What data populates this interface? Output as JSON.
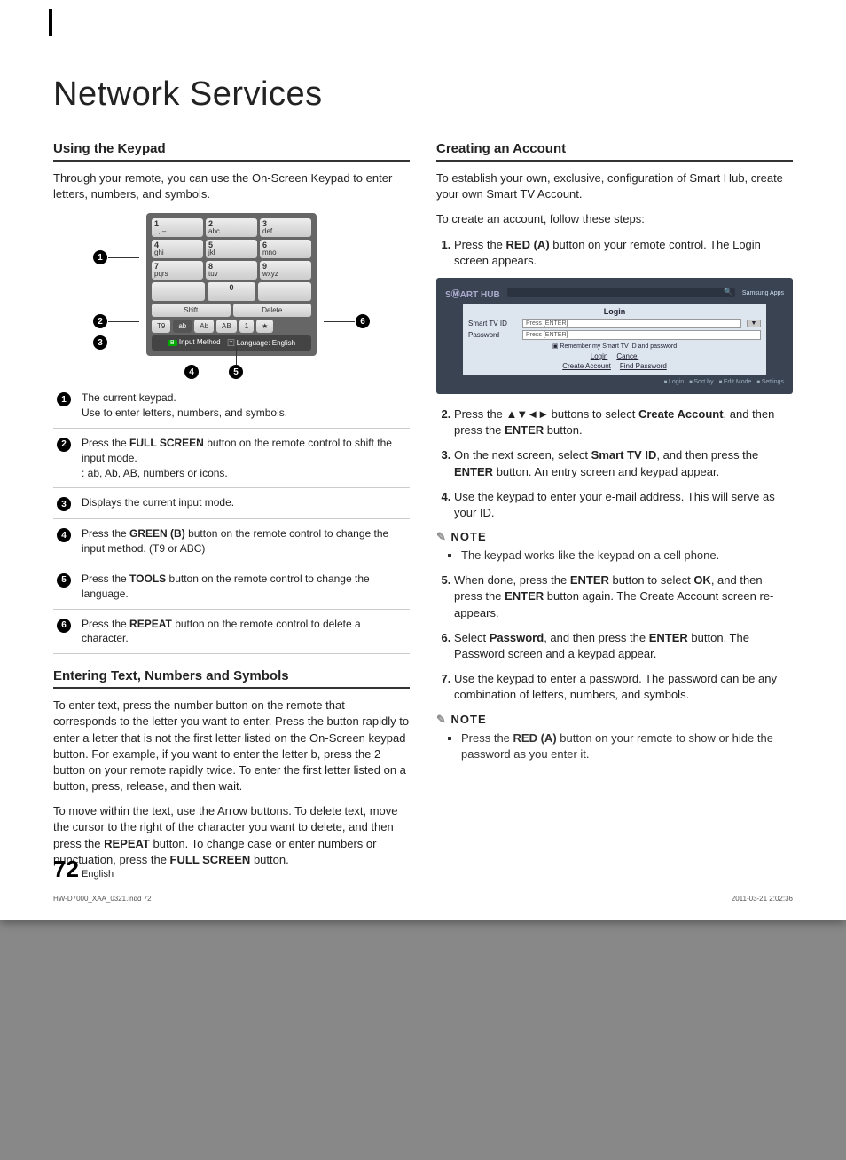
{
  "title": "Network Services",
  "left": {
    "h_keypad": "Using the Keypad",
    "p_keypad": "Through your remote, you can use the On-Screen Keypad to enter letters, numbers, and symbols.",
    "h_entering": "Entering Text, Numbers and Symbols",
    "p_entering1": "To enter text, press the number button on the remote that corresponds to the letter you want to enter. Press the button rapidly to enter a letter that is not the first letter listed on the On-Screen keypad button. For example, if you want to enter the letter b, press the 2 button on your remote rapidly twice. To enter the first letter listed on a button, press, release, and then wait.",
    "p_entering2a": "To move within the text, use the Arrow buttons. To delete text, move the cursor to the right of the character you want to delete, and then press the",
    "p_entering2_bold1": "REPEAT",
    "p_entering2b": "button. To change case or enter numbers or punctuation, press the",
    "p_entering2_bold2": "FULL SCREEN",
    "p_entering2c": "button."
  },
  "keypad": {
    "keys": [
      {
        "n": "1",
        "s": ". , –"
      },
      {
        "n": "2",
        "s": "abc"
      },
      {
        "n": "3",
        "s": "def"
      },
      {
        "n": "4",
        "s": "ghi"
      },
      {
        "n": "5",
        "s": "jkl"
      },
      {
        "n": "6",
        "s": "mno"
      },
      {
        "n": "7",
        "s": "pqrs"
      },
      {
        "n": "8",
        "s": "tuv"
      },
      {
        "n": "9",
        "s": "wxyz"
      },
      {
        "n": "0",
        "s": ""
      }
    ],
    "shift": "Shift",
    "delete": "Delete",
    "t9": "T9",
    "modes": [
      "ab",
      "Ab",
      "AB",
      "1",
      "★"
    ],
    "foot1": "Input Method",
    "foot2": "🅃 Language: English"
  },
  "legend": [
    {
      "a": "The current keypad.",
      "b": "Use to enter letters, numbers, and symbols."
    },
    {
      "a": "Press the",
      "bold": "FULL SCREEN",
      "b": "button on the remote control to shift the input mode.",
      "c": ": ab, Ab, AB, numbers or icons."
    },
    {
      "a": "Displays the current input mode."
    },
    {
      "a": "Press the",
      "bold": "GREEN (B)",
      "b": "button on the remote control to change the input method. (T9 or ABC)"
    },
    {
      "a": "Press the",
      "bold": "TOOLS",
      "b": "button on the remote control to change the language."
    },
    {
      "a": "Press the",
      "bold": "REPEAT",
      "b": "button on the remote control to delete a character."
    }
  ],
  "right": {
    "h_account": "Creating an Account",
    "p1": "To establish your own, exclusive, configuration of Smart Hub, create your own Smart TV Account.",
    "p2": "To create an account, follow these steps:",
    "note_label": "NOTE",
    "note1": "The keypad works like the keypad on a cell phone.",
    "note2a": "Press the",
    "note2bold": "RED (A)",
    "note2b": "button on your remote to show or hide the password as you enter it.",
    "steps": [
      {
        "a": "Press the",
        "bold": "RED (A)",
        "b": "button on your remote control. The Login screen appears."
      },
      {
        "a": "Press the",
        "b": "buttons to select",
        "bold1": "Create Account",
        "c": ", and then press the",
        "bold2": "ENTER",
        "d": "button."
      },
      {
        "a": "On the next screen, select",
        "bold1": "Smart TV ID",
        "b": ", and then press the",
        "bold2": "ENTER",
        "c": "button. An entry screen and keypad appear."
      },
      {
        "a": "Use the keypad to enter your e-mail address. This will serve as your ID."
      },
      {
        "a": "When done, press the",
        "bold1": "ENTER",
        "b": "button to select",
        "bold2": "OK",
        "c": ", and then press the",
        "bold3": "ENTER",
        "d": "button again. The Create Account screen re-appears."
      },
      {
        "a": "Select",
        "bold1": "Password",
        "b": ", and then press the",
        "bold2": "ENTER",
        "c": "button. The Password screen and a keypad appear."
      },
      {
        "a": "Use the keypad to enter a password. The password can be any combination of letters, numbers, and symbols."
      }
    ]
  },
  "login": {
    "logo": "SⓂART HUB",
    "apps": "Samsung Apps",
    "title": "Login",
    "f1": "Smart TV ID",
    "f2": "Password",
    "ph": "Press [ENTER]",
    "remember": "Remember my Smart TV ID and password",
    "b1": "Login",
    "b2": "Cancel",
    "b3": "Create Account",
    "b4": "Find Password",
    "bot": [
      "Login",
      "Sort by",
      "Edit Mode",
      "Settings"
    ]
  },
  "footer": {
    "file": "HW-D7000_XAA_0321.indd   72",
    "date": "2011-03-21   2:02:36",
    "page": "72",
    "lang": "English"
  }
}
